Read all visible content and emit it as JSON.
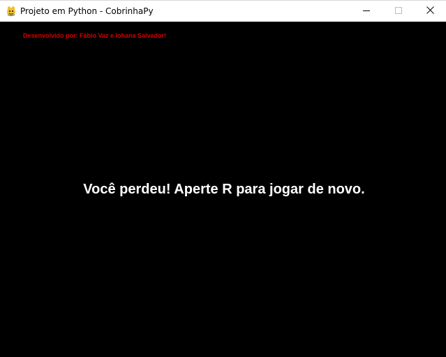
{
  "window": {
    "title": "Projeto em Python - CobrinhaPy",
    "icon": "pygame-snake-icon",
    "controls": {
      "minimize_icon": "minimize-icon",
      "maximize_icon": "maximize-icon",
      "close_icon": "close-icon"
    }
  },
  "game": {
    "credits": "Desenvolvido por: Fábio Vaz e Iohana Salvador!",
    "message": "Você perdeu! Aperte R para jogar de novo.",
    "background_color": "#000000",
    "credits_color": "#d40000",
    "message_color": "#ffffff"
  }
}
